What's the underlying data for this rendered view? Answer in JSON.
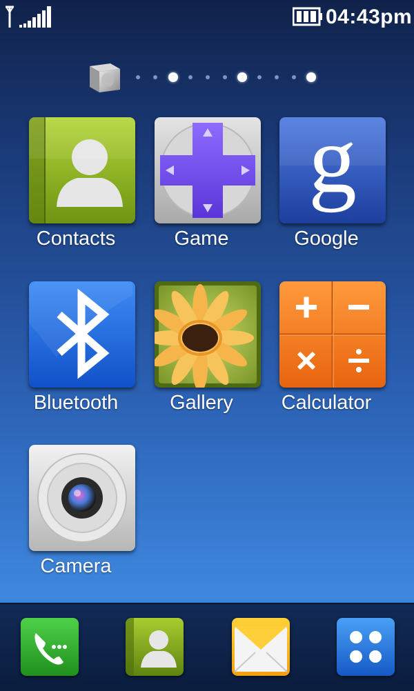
{
  "status_bar": {
    "time": "04:43pm",
    "signal_icon": "signal-bars-icon",
    "battery_icon": "battery-full-icon"
  },
  "pager": {
    "page_count": 10,
    "highlighted_dots": [
      2,
      6,
      10
    ]
  },
  "apps": [
    {
      "label": "Contacts",
      "icon": "contacts-icon"
    },
    {
      "label": "Game",
      "icon": "game-dpad-icon"
    },
    {
      "label": "Google",
      "icon": "google-icon"
    },
    {
      "label": "Bluetooth",
      "icon": "bluetooth-icon"
    },
    {
      "label": "Gallery",
      "icon": "gallery-flower-icon"
    },
    {
      "label": "Calculator",
      "icon": "calculator-icon"
    },
    {
      "label": "Camera",
      "icon": "camera-icon"
    }
  ],
  "dock": [
    {
      "icon": "phone-icon"
    },
    {
      "icon": "contacts-icon"
    },
    {
      "icon": "messages-envelope-icon"
    },
    {
      "icon": "apps-menu-icon"
    }
  ],
  "colors": {
    "background_top": "#10224a",
    "background_bottom": "#3d87de",
    "contacts_green": "#8cb520",
    "game_purple": "#7b55f0",
    "google_blue": "#2b56c2",
    "bluetooth_blue": "#1f6ee0",
    "calculator_orange": "#f07a1a"
  }
}
